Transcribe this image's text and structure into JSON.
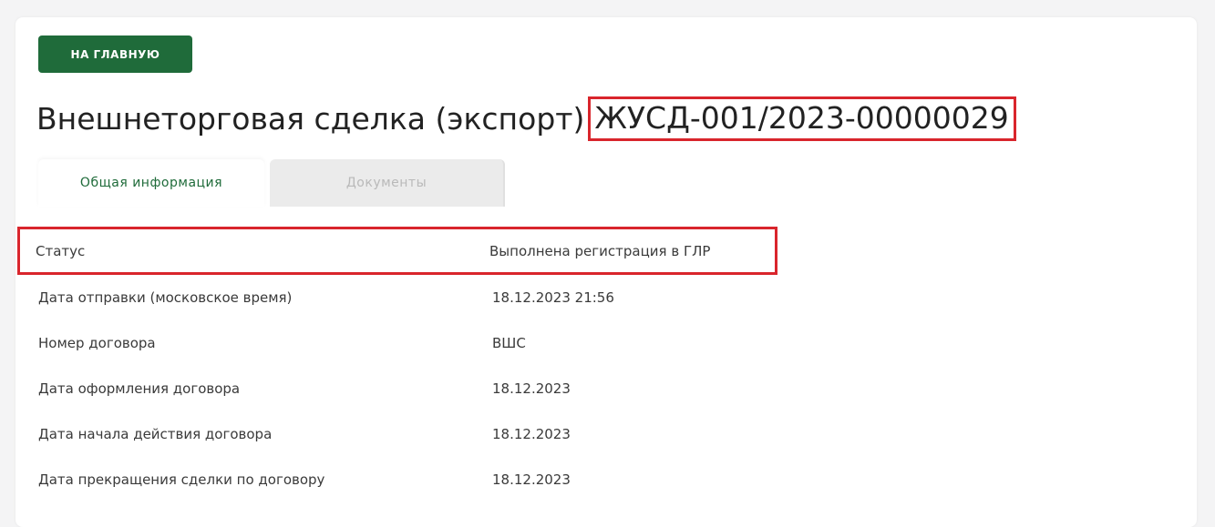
{
  "header": {
    "home_button_label": "НА ГЛАВНУЮ",
    "title_prefix": "Внешнеторговая сделка (экспорт)",
    "document_number": "ЖУСД-001/2023-00000029"
  },
  "tabs": [
    {
      "label": "Общая информация",
      "active": true
    },
    {
      "label": "Документы",
      "active": false
    }
  ],
  "details": [
    {
      "label": "Статус",
      "value": "Выполнена регистрация в ГЛР"
    },
    {
      "label": "Дата отправки (московское время)",
      "value": "18.12.2023 21:56"
    },
    {
      "label": "Номер договора",
      "value": "ВШС"
    },
    {
      "label": "Дата оформления договора",
      "value": "18.12.2023"
    },
    {
      "label": "Дата начала действия договора",
      "value": "18.12.2023"
    },
    {
      "label": "Дата прекращения сделки по договору",
      "value": "18.12.2023"
    }
  ],
  "colors": {
    "accent": "#1f6b3a",
    "highlight": "#d9252c",
    "background": "#f4f4f5"
  }
}
